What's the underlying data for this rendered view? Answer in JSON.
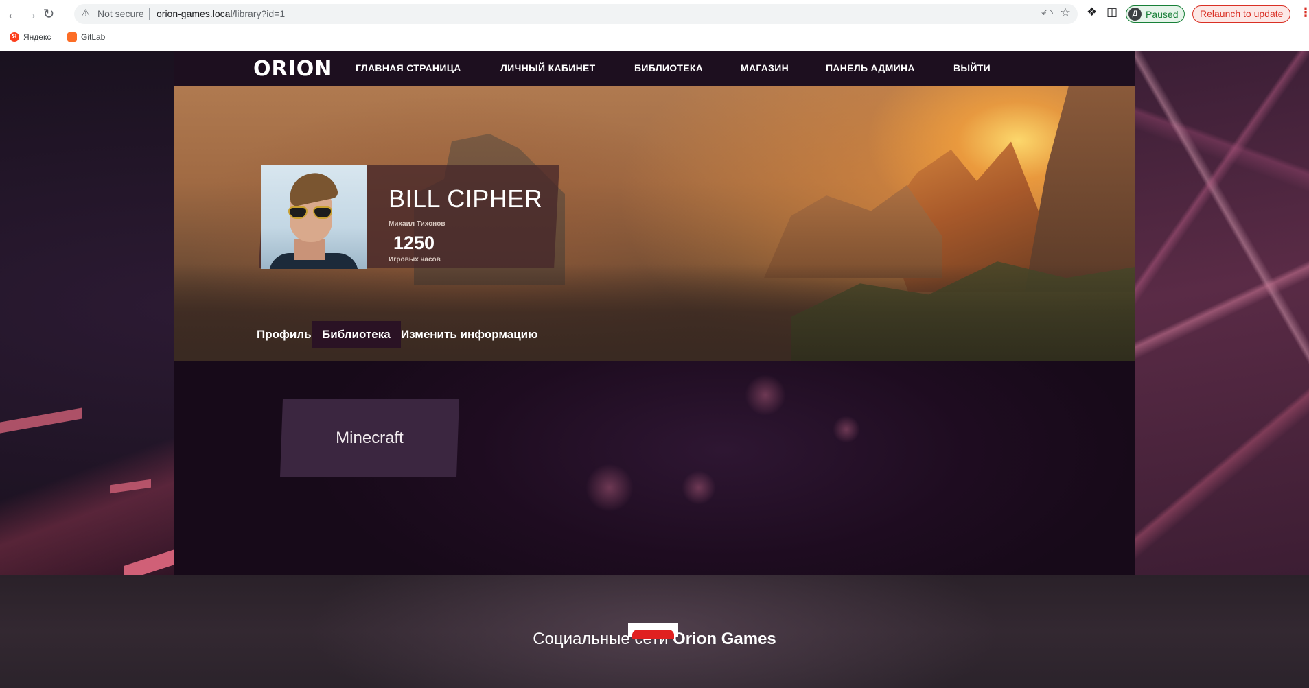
{
  "browser": {
    "security_label": "Not secure",
    "url_host": "orion-games.local",
    "url_path": "/library?id=1",
    "profile_initial": "Д",
    "profile_status": "Paused",
    "relaunch_label": "Relaunch to update",
    "bookmarks": [
      {
        "label": "Яндекс",
        "icon": "yandex-icon"
      },
      {
        "label": "GitLab",
        "icon": "gitlab-icon"
      }
    ]
  },
  "site": {
    "logo": "ORION",
    "nav": [
      "ГЛАВНАЯ СТРАНИЦА",
      "ЛИЧНЫЙ КАБИНЕТ",
      "БИБЛИОТЕКА",
      "МАГАЗИН",
      "ПАНЕЛЬ АДМИНА",
      "ВЫЙТИ"
    ]
  },
  "profile": {
    "username": "BILL CIPHER",
    "real_name": "Михаил Тихонов",
    "hours_value": "1250",
    "hours_label": "Игровых часов"
  },
  "tabs": {
    "items": [
      "Профиль",
      "Библиотека",
      "Изменить информацию"
    ],
    "active": "Библиотека"
  },
  "library": {
    "games": [
      "Minecraft"
    ]
  },
  "footer": {
    "title_prefix": "Социальные сети",
    "title_brand": "Orion Games"
  },
  "colors": {
    "accent_green": "#188038",
    "accent_red": "#d93025",
    "nav_bg": "#1d0f1f",
    "active_tab_bg": "#2a1224"
  }
}
